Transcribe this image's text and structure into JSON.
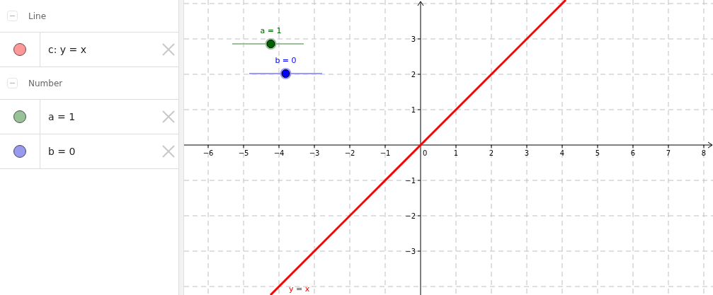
{
  "algebra": {
    "groups": [
      {
        "title": "Line",
        "expanded": true,
        "items": [
          {
            "text": "c: y = x",
            "color": "#ff9999"
          }
        ]
      },
      {
        "title": "Number",
        "expanded": true,
        "items": [
          {
            "text": "a = 1",
            "color": "#99c299"
          },
          {
            "text": "b = 0",
            "color": "#9999ee"
          }
        ]
      }
    ]
  },
  "graphics": {
    "x_ticks": [
      "−6",
      "−5",
      "−4",
      "−3",
      "−2",
      "−1",
      "0",
      "1",
      "2",
      "3",
      "4",
      "5",
      "6",
      "7",
      "8"
    ],
    "y_ticks": [
      "3",
      "2",
      "1",
      "−1",
      "−2",
      "−3"
    ],
    "line": {
      "label": "y = x",
      "color": "#ff0000"
    },
    "sliders": [
      {
        "label": "a = 1",
        "level": 0.54,
        "color": "#006400"
      },
      {
        "label": "b = 0",
        "level": 0.5,
        "color": "#0000ff"
      }
    ]
  }
}
